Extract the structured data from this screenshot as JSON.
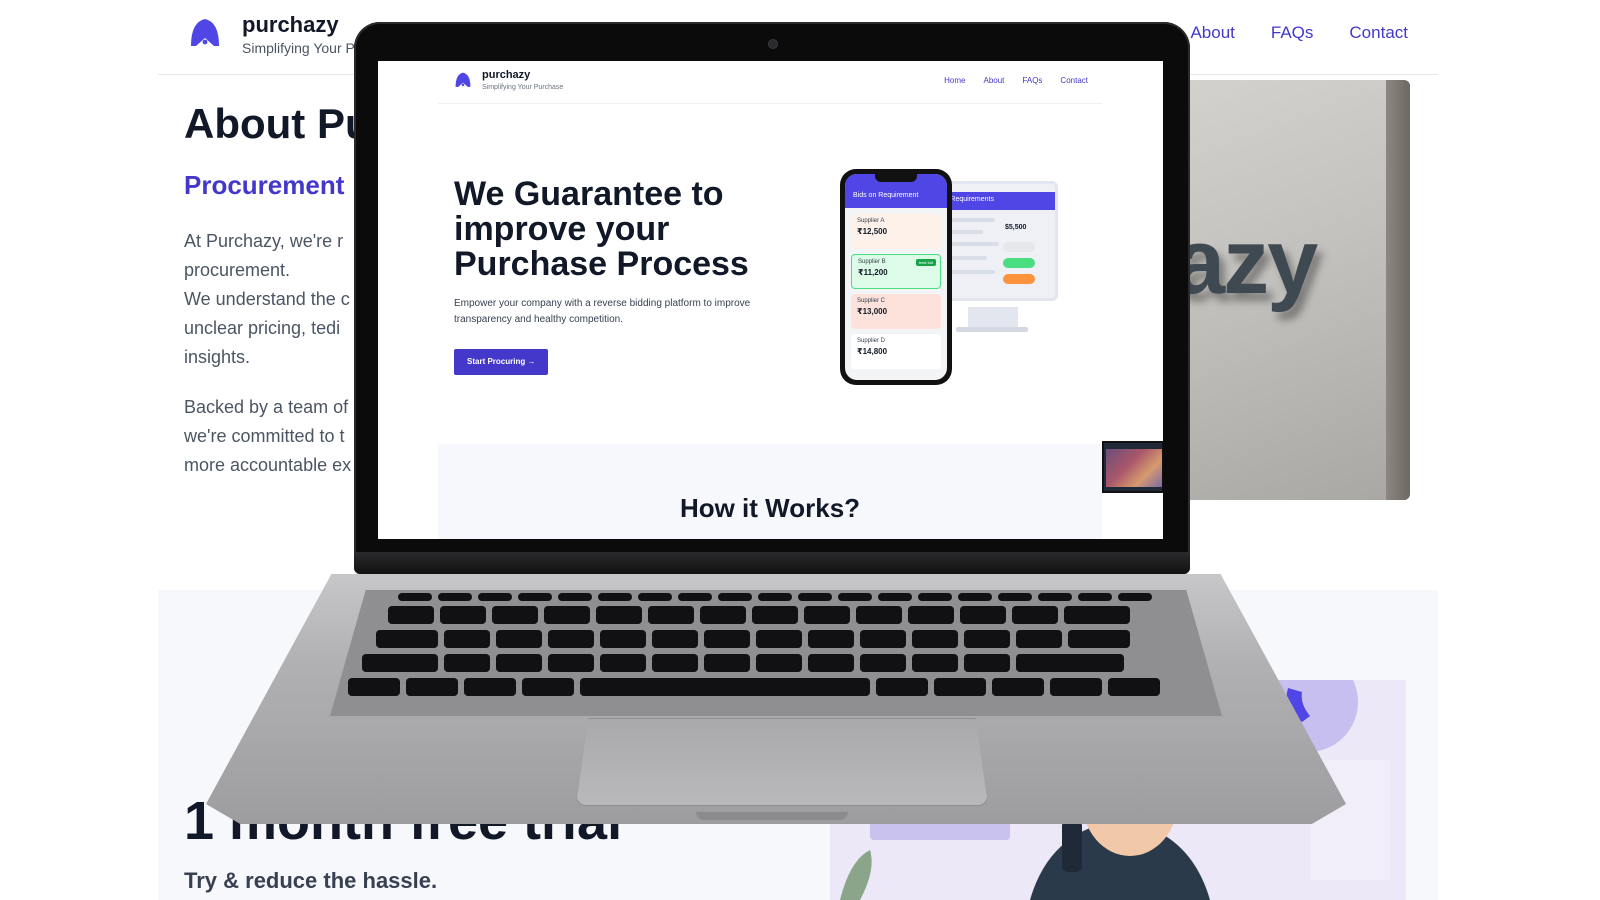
{
  "background_page": {
    "brand": "purchazy",
    "tagline": "Simplifying Your P",
    "nav": [
      "About",
      "FAQs",
      "Contact"
    ],
    "about_title": "About Pu",
    "about_subtitle": "Procurement",
    "para1": [
      "At Purchazy, we're r",
      "procurement.",
      "We understand the c",
      "unclear pricing, tedi",
      "insights."
    ],
    "para2": [
      "Backed by a team of",
      "we're committed to t",
      "more accountable ex"
    ],
    "photo_text": "azy",
    "trial_title": "1 month free trial",
    "trial_subtitle": "Try & reduce the hassle."
  },
  "screen": {
    "brand": "purchazy",
    "tagline": "Simplifying Your Purchase",
    "nav": [
      "Home",
      "About",
      "FAQs",
      "Contact"
    ],
    "hero_title": "We Guarantee to improve your Purchase Process",
    "hero_desc": "Empower your company with a reverse bidding platform to improve transparency and healthy competition.",
    "cta": "Start Procuring →",
    "how_title": "How it Works?",
    "phone": {
      "header": "Bids on Requirement",
      "bids": [
        {
          "name": "Supplier A",
          "amount": "₹12,500",
          "color": "#fdf1ea"
        },
        {
          "name": "Supplier B",
          "amount": "₹11,200",
          "color": "#dcfce7",
          "badge": "best bid"
        },
        {
          "name": "Supplier C",
          "amount": "₹13,000",
          "color": "#fde2dc"
        },
        {
          "name": "Supplier D",
          "amount": "₹14,800",
          "color": "#ffffff"
        }
      ]
    },
    "monitor": {
      "header": "st Requirements",
      "price": "$5,500"
    }
  },
  "colors": {
    "accent": "#4338ca",
    "heading": "#111827"
  }
}
